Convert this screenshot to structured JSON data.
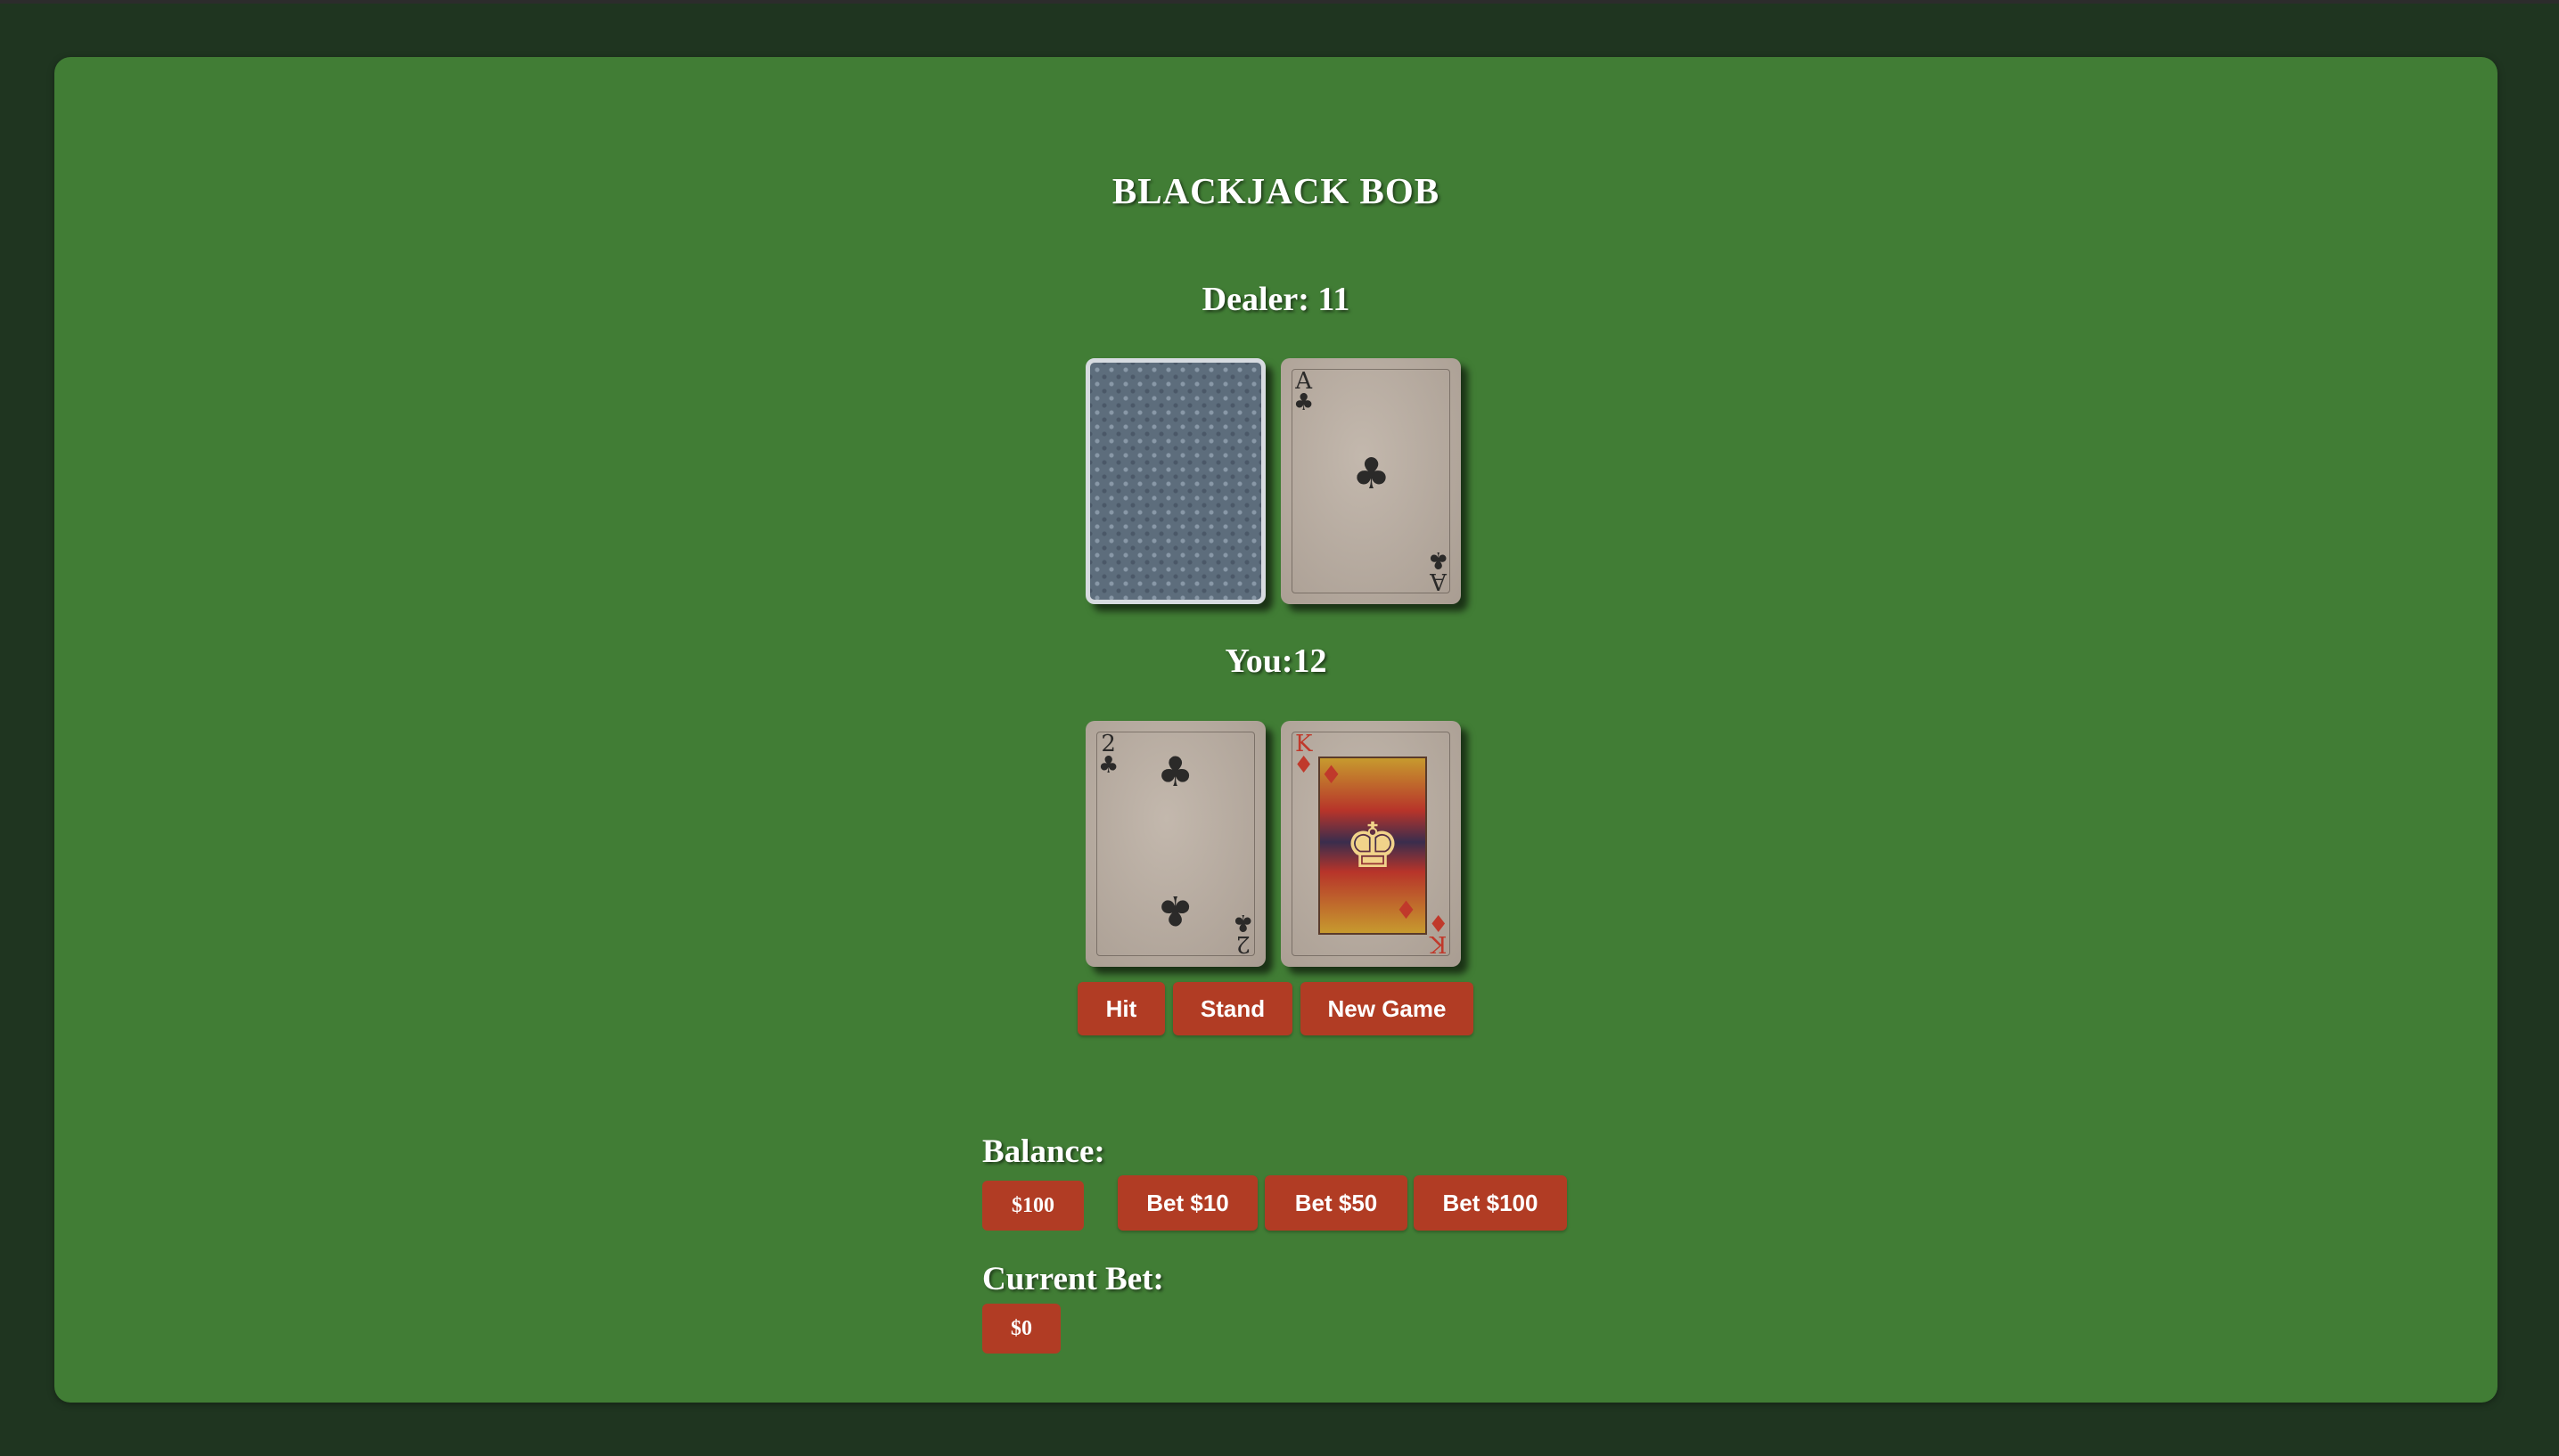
{
  "title": "BLACKJACK BOB",
  "dealer": {
    "label": "Dealer: 11",
    "cards": [
      {
        "face_down": true
      },
      {
        "rank": "A",
        "suit": "♣",
        "color": "black"
      }
    ]
  },
  "player": {
    "label": "You:12",
    "cards": [
      {
        "rank": "2",
        "suit": "♣",
        "color": "black"
      },
      {
        "rank": "K",
        "suit": "♦",
        "color": "red"
      }
    ]
  },
  "actions": {
    "hit": "Hit",
    "stand": "Stand",
    "new_game": "New Game"
  },
  "balance": {
    "label": "Balance:",
    "value": "$100"
  },
  "bets": {
    "bet10": "Bet $10",
    "bet50": "Bet $50",
    "bet100": "Bet $100"
  },
  "current_bet": {
    "label": "Current Bet:",
    "value": "$0"
  },
  "colors": {
    "felt": "#417d35",
    "background": "#1f3520",
    "button": "#b13c24",
    "text": "#ffffff"
  }
}
